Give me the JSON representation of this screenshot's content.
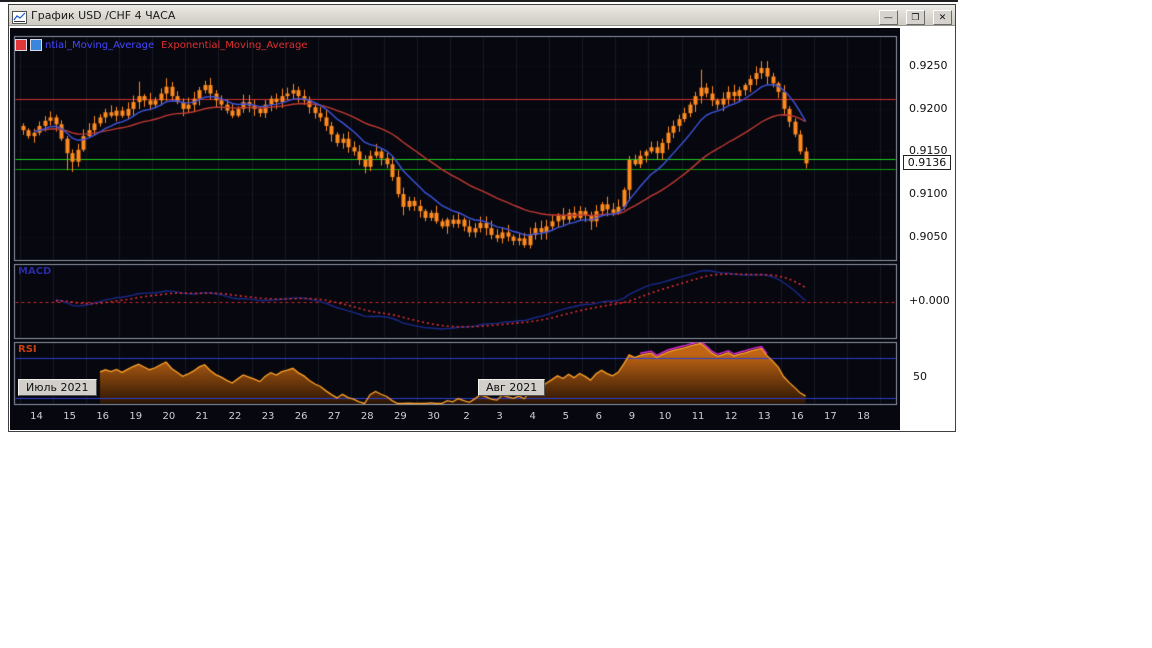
{
  "window": {
    "title": "График USD /CHF  4 ЧАСА",
    "buttons": [
      {
        "name": "minimize",
        "glyph": "—"
      },
      {
        "name": "maximize",
        "glyph": "❐"
      },
      {
        "name": "close",
        "glyph": "✕"
      }
    ]
  },
  "legend": {
    "fast_label_visible": "ntial_Moving_Average",
    "slow_label": "Exponential_Moving_Average"
  },
  "panels": {
    "macd_label": "MACD",
    "macd_axis_label": "+0.000",
    "rsi_label": "RSI",
    "rsi_axis_label": "50"
  },
  "price_axis": {
    "labels": [
      "0.9250",
      "0.9200",
      "0.9150",
      "0.9100",
      "0.9050"
    ],
    "current_label": "0.9136"
  },
  "markers": {
    "left": "Июль 2021",
    "right": "Авг 2021"
  },
  "colors": {
    "chart_bg": "#06070f",
    "candle": "#ff8a1e",
    "ema_fast": "#3d55dc",
    "ema_slow": "#c23a32",
    "macd_line": "#1a2a8a",
    "macd_signal": "#e03030",
    "macd_zero": "#c82828",
    "rsi_line": "#ffa228",
    "rsi_fill_top": "#be6414",
    "rsi_fill_bottom": "#2d1604",
    "rsi_levels": "#2d3fd0",
    "rsi_overbought": "#e02ad8",
    "hline_red": "#d03030",
    "hline_green": "#1ecb1e"
  },
  "chart_data": {
    "type": "candlestick",
    "title": "USD/CHF 4H with EMA, MACD, RSI",
    "x_ticks": [
      "14",
      "15",
      "16",
      "19",
      "20",
      "21",
      "22",
      "23",
      "26",
      "27",
      "28",
      "29",
      "30",
      "2",
      "3",
      "4",
      "5",
      "6",
      "9",
      "10",
      "11",
      "12",
      "13",
      "16",
      "17",
      "18"
    ],
    "bars_per_tick": 6,
    "first_open": 0.918,
    "closes": [
      0.9175,
      0.9168,
      0.9172,
      0.918,
      0.9186,
      0.919,
      0.9182,
      0.9165,
      0.9148,
      0.9138,
      0.9152,
      0.9168,
      0.9175,
      0.9183,
      0.919,
      0.9196,
      0.9192,
      0.9198,
      0.9192,
      0.92,
      0.9208,
      0.9215,
      0.921,
      0.9205,
      0.921,
      0.9218,
      0.9226,
      0.9215,
      0.9208,
      0.92,
      0.9205,
      0.9212,
      0.9222,
      0.9228,
      0.9218,
      0.921,
      0.9205,
      0.9198,
      0.9192,
      0.92,
      0.9208,
      0.9204,
      0.92,
      0.9195,
      0.9205,
      0.9212,
      0.9208,
      0.9215,
      0.9218,
      0.9222,
      0.9215,
      0.921,
      0.9202,
      0.9195,
      0.919,
      0.918,
      0.917,
      0.916,
      0.9165,
      0.9155,
      0.915,
      0.914,
      0.9132,
      0.9145,
      0.915,
      0.9142,
      0.9135,
      0.912,
      0.91,
      0.9085,
      0.9092,
      0.9086,
      0.908,
      0.9072,
      0.9078,
      0.9068,
      0.9062,
      0.907,
      0.9065,
      0.907,
      0.9062,
      0.9055,
      0.906,
      0.9066,
      0.906,
      0.9052,
      0.9048,
      0.9055,
      0.905,
      0.9045,
      0.9048,
      0.904,
      0.9052,
      0.906,
      0.9055,
      0.9062,
      0.9068,
      0.9075,
      0.907,
      0.9078,
      0.9072,
      0.908,
      0.9075,
      0.9068,
      0.908,
      0.9088,
      0.9082,
      0.9078,
      0.9085,
      0.9105,
      0.914,
      0.9135,
      0.9145,
      0.915,
      0.9155,
      0.9148,
      0.916,
      0.9172,
      0.918,
      0.9188,
      0.9195,
      0.9205,
      0.9215,
      0.9225,
      0.9218,
      0.921,
      0.9205,
      0.9212,
      0.922,
      0.9215,
      0.9222,
      0.9228,
      0.9235,
      0.9242,
      0.9248,
      0.9238,
      0.923,
      0.922,
      0.92,
      0.9185,
      0.917,
      0.915,
      0.9136
    ],
    "spikes": {
      "8": {
        "low": 0.9128
      },
      "9": {
        "low": 0.9126
      },
      "21": {
        "high": 0.9232
      },
      "26": {
        "high": 0.9236
      },
      "33": {
        "high": 0.9233
      },
      "69": {
        "low": 0.9075
      },
      "91": {
        "low": 0.9037
      },
      "103": {
        "low": 0.9058
      },
      "110": {
        "low": 0.9092
      },
      "123": {
        "high": 0.9246
      },
      "134": {
        "high": 0.9256
      },
      "142": {
        "low": 0.913
      }
    },
    "price_range": {
      "top": 0.9285,
      "bottom": 0.9022
    },
    "axis_prices": [
      0.925,
      0.92,
      0.915,
      0.91,
      0.905
    ],
    "current_price": 0.9136,
    "hlines": [
      {
        "price": 0.9212,
        "color": "#d03030",
        "style": "solid"
      },
      {
        "price": 0.9141,
        "color": "#1ecb1e",
        "style": "solid"
      },
      {
        "price": 0.9129,
        "color": "#0f9b0f",
        "style": "solid"
      }
    ],
    "indicators": {
      "ema_fast_period": 10,
      "ema_slow_period": 30,
      "macd": {
        "fast": 12,
        "slow": 26,
        "signal": 9,
        "zero_label": "+0.000"
      },
      "rsi": {
        "period": 14,
        "levels": [
          70,
          50,
          30
        ],
        "level_lines": [
          70,
          30
        ],
        "axis_label": "50"
      }
    }
  }
}
